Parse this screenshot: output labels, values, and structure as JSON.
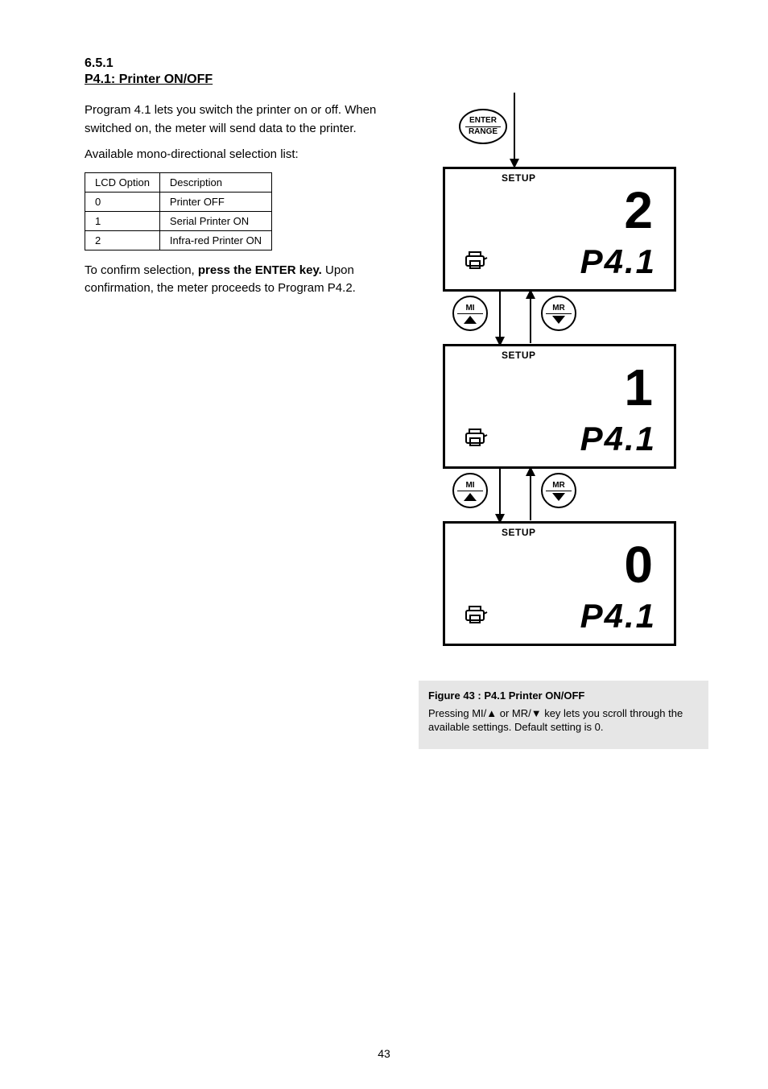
{
  "section": {
    "number": "6.5.1",
    "title": "P4.1: Printer ON/OFF",
    "para1": "Program 4.1 lets you switch the printer on or off. When switched on, the meter will send data to the printer.",
    "para2": "Available mono-directional selection list:",
    "para3_prefix": "To confirm selection, ",
    "para3_action": "press the ENTER key.",
    "para3_suffix": " Upon confirmation, the meter proceeds to Program P4.2."
  },
  "table": {
    "rows": [
      [
        "LCD Option",
        "Description"
      ],
      [
        "0",
        "Printer OFF"
      ],
      [
        "1",
        "Serial Printer ON"
      ],
      [
        "2",
        "Infra-red Printer ON"
      ]
    ]
  },
  "buttons": {
    "enter": "ENTER",
    "range": "RANGE",
    "mi": "MI",
    "mr": "MR"
  },
  "lcd": {
    "setup_label": "SETUP",
    "param": "P4.1",
    "screens": [
      {
        "digit": "2"
      },
      {
        "digit": "1"
      },
      {
        "digit": "0"
      }
    ]
  },
  "figure": {
    "title": "Figure 43 : P4.1 Printer ON/OFF",
    "caption": "Pressing MI/▲ or MR/▼ key lets you scroll through the available settings. Default setting is 0."
  },
  "page_number": "43"
}
